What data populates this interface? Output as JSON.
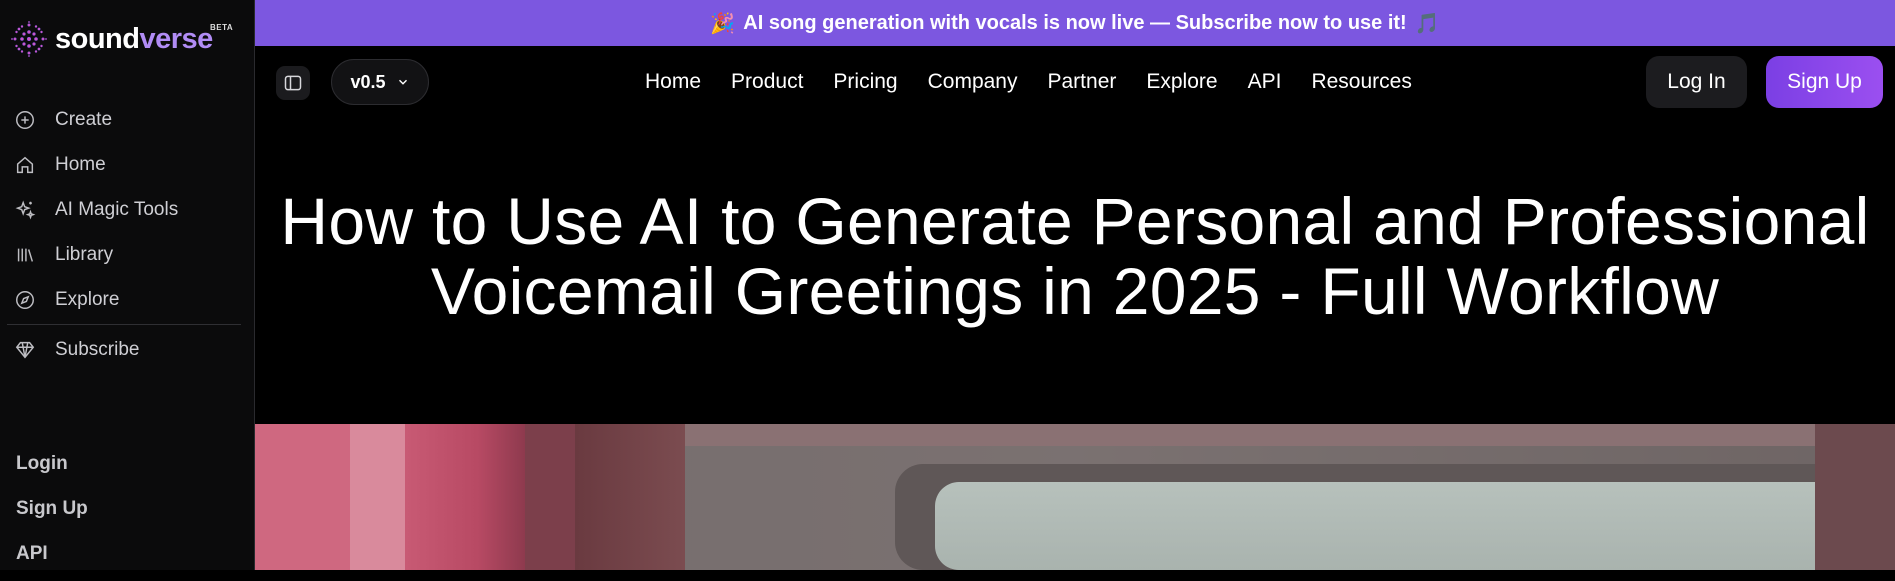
{
  "brand": {
    "name_part1": "sound",
    "name_part2": "verse",
    "badge": "BETA"
  },
  "sidebar": {
    "items": [
      {
        "label": "Create",
        "icon": "plus-circle-icon"
      },
      {
        "label": "Home",
        "icon": "home-icon"
      },
      {
        "label": "AI Magic Tools",
        "icon": "sparkles-icon"
      },
      {
        "label": "Library",
        "icon": "library-icon"
      },
      {
        "label": "Explore",
        "icon": "compass-icon"
      }
    ],
    "subscribe": {
      "label": "Subscribe",
      "icon": "diamond-icon"
    },
    "bottom_links": [
      "Login",
      "Sign Up",
      "API"
    ]
  },
  "banner": {
    "text": "AI song generation with vocals is now live — Subscribe now to use it!",
    "emoji_left": "🎉",
    "emoji_right": "🎵"
  },
  "topnav": {
    "version": "v0.5",
    "menu": [
      "Home",
      "Product",
      "Pricing",
      "Company",
      "Partner",
      "Explore",
      "API",
      "Resources"
    ],
    "login_label": "Log In",
    "signup_label": "Sign Up"
  },
  "article": {
    "title_line1": "How to Use AI to Generate Personal and Professional",
    "title_line2": "Voicemail Greetings in 2025 - Full Workflow"
  },
  "colors": {
    "banner": "#7c57e0",
    "accent": "#9b4ff0",
    "background": "#000000"
  }
}
